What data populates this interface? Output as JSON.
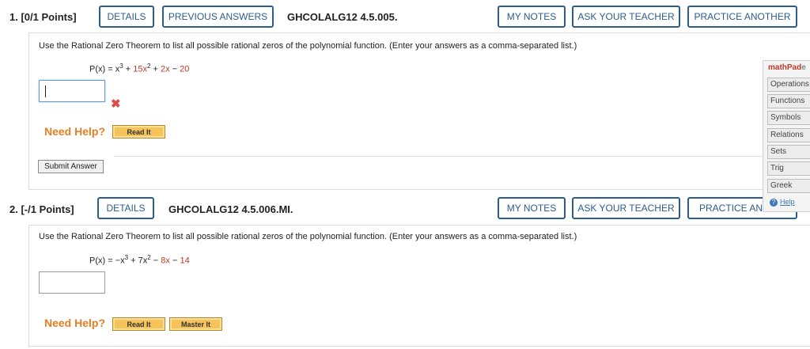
{
  "question1": {
    "number": "1.",
    "points": "[0/1 Points]",
    "details_label": "DETAILS",
    "previous_answers_label": "PREVIOUS ANSWERS",
    "code": "GHCOLALG12 4.5.005.",
    "my_notes_label": "MY NOTES",
    "ask_teacher_label": "ASK YOUR TEACHER",
    "practice_another_label": "PRACTICE ANOTHER",
    "prompt": "Use the Rational Zero Theorem to list all possible rational zeros of the polynomial function. (Enter your answers as a comma-separated list.)",
    "poly_lhs": "P(x) = x",
    "poly_exp1": "3",
    "poly_plus1": "+",
    "poly_coef2": "15x",
    "poly_exp2": "2",
    "poly_plus2": "+",
    "poly_coef3": "2x",
    "poly_minus": "−",
    "poly_const": "20",
    "answer_value": "",
    "incorrect_mark": "✖",
    "need_help": "Need Help?",
    "read_it_label": "Read It",
    "submit_label": "Submit Answer"
  },
  "question2": {
    "number": "2.",
    "points": "[-/1 Points]",
    "details_label": "DETAILS",
    "code": "GHCOLALG12 4.5.006.MI.",
    "my_notes_label": "MY NOTES",
    "ask_teacher_label": "ASK YOUR TEACHER",
    "practice_another_label": "PRACTICE ANO",
    "prompt": "Use the Rational Zero Theorem to list all possible rational zeros of the polynomial function. (Enter your answers as a comma-separated list.)",
    "poly_lhs": "P(x) = −x",
    "poly_exp1": "3",
    "poly_plus1": "+",
    "poly_coef2": "7x",
    "poly_exp2": "2",
    "poly_minus1": "−",
    "poly_coef3": "8x",
    "poly_minus2": "−",
    "poly_const": "14",
    "answer_value": "",
    "need_help": "Need Help?",
    "read_it_label": "Read It",
    "master_it_label": "Master It"
  },
  "mathpad": {
    "title_main": "mathPad",
    "title_tail": "e",
    "items": [
      "Operations",
      "Functions",
      "Symbols",
      "Relations",
      "Sets",
      "Trig",
      "Greek"
    ],
    "help_label": "Help",
    "help_icon": "?"
  },
  "colors": {
    "button_blue": "#2c5d8f",
    "need_help_orange": "#e67e22",
    "wrong_red": "#e04a4a",
    "red_coefficient": "#c0392b",
    "read_it_yellow": "#f6c25a"
  }
}
